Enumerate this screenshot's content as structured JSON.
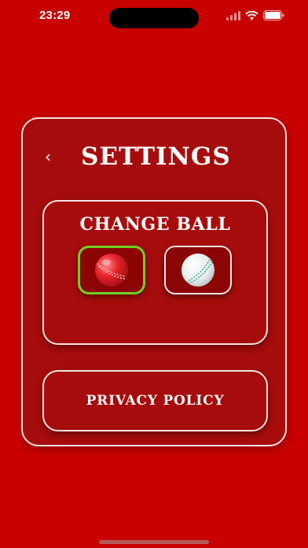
{
  "status_bar": {
    "time": "23:29",
    "battery_level": 0.95
  },
  "settings": {
    "title": "SETTINGS",
    "back_glyph": "‹",
    "change_ball": {
      "title": "CHANGE BALL",
      "options": [
        {
          "name": "red-cricket-ball",
          "selected": true
        },
        {
          "name": "white-cricket-ball",
          "selected": false
        }
      ]
    },
    "privacy_label": "PRIVACY POLICY"
  },
  "colors": {
    "background": "#c80000",
    "card": "#a70c0c",
    "border": "#f3e2e2",
    "selected_border": "#6fd11e"
  }
}
